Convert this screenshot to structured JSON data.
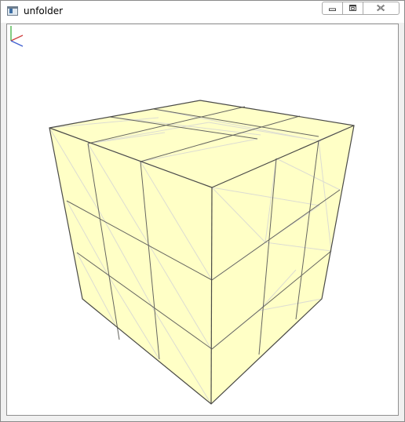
{
  "window": {
    "title": "unfolder",
    "icon": "app-window-icon"
  },
  "caption_buttons": {
    "minimize": "minimize-icon",
    "maximize": "maximize-icon",
    "close": "close-icon"
  },
  "scene": {
    "object": "cube",
    "subdivisions": 3,
    "face_color": "#ffffc6",
    "edge_color": "#555555",
    "triangle_edge_color": "#d8d8d8",
    "axes_colors": {
      "x": "#d04040",
      "y": "#40b040",
      "z": "#4060d0"
    }
  }
}
